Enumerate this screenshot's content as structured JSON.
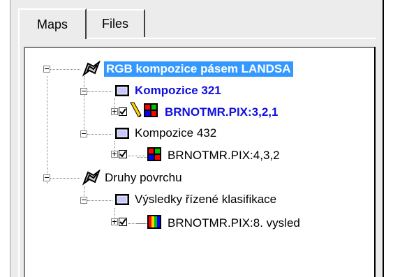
{
  "tabs": [
    {
      "label": "Maps",
      "active": true
    },
    {
      "label": "Files",
      "active": false
    }
  ],
  "tree": {
    "root1": {
      "label": "RGB kompozice pásem LANDSA",
      "selected": true
    },
    "comp321": {
      "label": "Kompozice 321"
    },
    "file321": {
      "label": "BRNOTMR.PIX:3,2,1",
      "checked": true
    },
    "comp432": {
      "label": "Kompozice 432"
    },
    "file432": {
      "label": "BRNOTMR.PIX:4,3,2",
      "checked": true
    },
    "root2": {
      "label": "Druhy povrchu"
    },
    "classif": {
      "label": "Výsledky řízené klasifikace"
    },
    "fileclass": {
      "label": "BRNOTMR.PIX:8. vysled",
      "checked": true
    }
  },
  "colors": {
    "selection": "#3399ff",
    "highlight_text": "#1010e0",
    "panel": "#ececec"
  }
}
